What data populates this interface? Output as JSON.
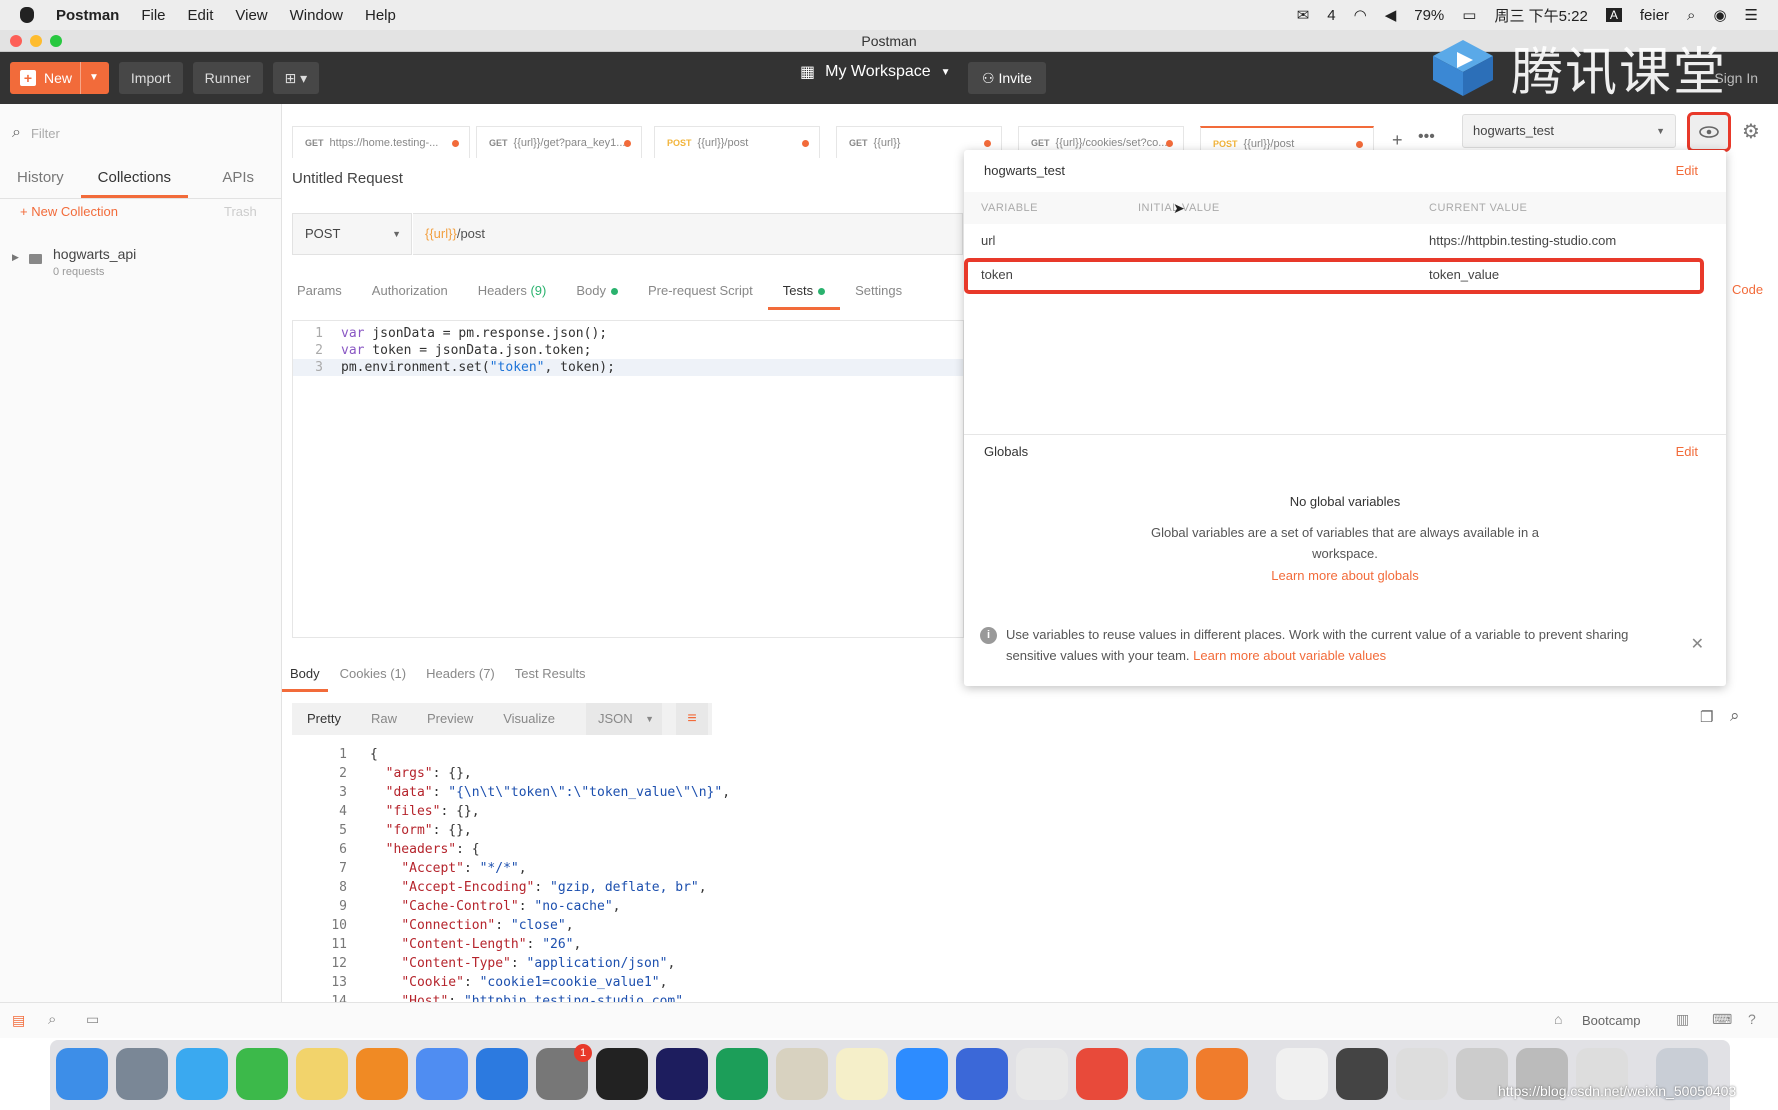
{
  "menubar": {
    "app_name": "Postman",
    "items": [
      "File",
      "Edit",
      "View",
      "Window",
      "Help"
    ],
    "wechat_count": "4",
    "battery": "79%",
    "clock": "周三 下午5:22",
    "user": "feier"
  },
  "window": {
    "title": "Postman"
  },
  "toolbar": {
    "new_label": "New",
    "import_label": "Import",
    "runner_label": "Runner",
    "workspace_label": "My Workspace",
    "invite_label": "Invite",
    "signin_label": "Sign In"
  },
  "watermark": {
    "text": "腾讯课堂"
  },
  "sidebar": {
    "filter_placeholder": "Filter",
    "tabs": [
      "History",
      "Collections",
      "APIs"
    ],
    "active_tab": "Collections",
    "new_collection_label": "New Collection",
    "trash_label": "Trash",
    "collections": [
      {
        "name": "hogwarts_api",
        "subtitle": "0 requests"
      }
    ]
  },
  "request_tabs": [
    {
      "method": "GET",
      "label": "https://home.testing-..."
    },
    {
      "method": "GET",
      "label": "{{url}}/get?para_key1..."
    },
    {
      "method": "POST",
      "label": "{{url}}/post"
    },
    {
      "method": "GET",
      "label": "{{url}}"
    },
    {
      "method": "GET",
      "label": "{{url}}/cookies/set?co..."
    },
    {
      "method": "POST",
      "label": "{{url}}/post"
    }
  ],
  "env_selector": {
    "selected": "hogwarts_test"
  },
  "request": {
    "name": "Untitled Request",
    "method": "POST",
    "url_var": "{{url}}",
    "url_path": "/post",
    "option_tabs": {
      "params": "Params",
      "authorization": "Authorization",
      "headers": "Headers",
      "headers_count": "(9)",
      "body": "Body",
      "prerequest": "Pre-request Script",
      "tests": "Tests",
      "settings": "Settings"
    },
    "code_label": "Code",
    "test_script": {
      "line_numbers": [
        "1",
        "2",
        "3"
      ],
      "l1_kw": "var",
      "l1_rest": " jsonData = pm.response.json();",
      "l2_kw": "var",
      "l2_rest": " token = jsonData.json.token;",
      "l3_a": "pm.environment.set(",
      "l3_str": "\"token\"",
      "l3_b": ", token);"
    }
  },
  "response": {
    "tabs": {
      "body": "Body",
      "cookies": "Cookies (1)",
      "headers": "Headers (7)",
      "test_results": "Test Results"
    },
    "view_buttons": [
      "Pretty",
      "Raw",
      "Preview",
      "Visualize"
    ],
    "format": "JSON",
    "body_lines": [
      {
        "n": "1",
        "indent": "",
        "key": "",
        "val": "",
        "raw": "{"
      },
      {
        "n": "2",
        "indent": "  ",
        "key": "\"args\"",
        "val": "",
        "raw": ": {},"
      },
      {
        "n": "3",
        "indent": "  ",
        "key": "\"data\"",
        "val": "\"{\\n\\t\\\"token\\\":\\\"token_value\\\"\\n}\"",
        "raw": ","
      },
      {
        "n": "4",
        "indent": "  ",
        "key": "\"files\"",
        "val": "",
        "raw": ": {},"
      },
      {
        "n": "5",
        "indent": "  ",
        "key": "\"form\"",
        "val": "",
        "raw": ": {},"
      },
      {
        "n": "6",
        "indent": "  ",
        "key": "\"headers\"",
        "val": "",
        "raw": ": {"
      },
      {
        "n": "7",
        "indent": "    ",
        "key": "\"Accept\"",
        "val": "\"*/*\"",
        "raw": ","
      },
      {
        "n": "8",
        "indent": "    ",
        "key": "\"Accept-Encoding\"",
        "val": "\"gzip, deflate, br\"",
        "raw": ","
      },
      {
        "n": "9",
        "indent": "    ",
        "key": "\"Cache-Control\"",
        "val": "\"no-cache\"",
        "raw": ","
      },
      {
        "n": "10",
        "indent": "    ",
        "key": "\"Connection\"",
        "val": "\"close\"",
        "raw": ","
      },
      {
        "n": "11",
        "indent": "    ",
        "key": "\"Content-Length\"",
        "val": "\"26\"",
        "raw": ","
      },
      {
        "n": "12",
        "indent": "    ",
        "key": "\"Content-Type\"",
        "val": "\"application/json\"",
        "raw": ","
      },
      {
        "n": "13",
        "indent": "    ",
        "key": "\"Cookie\"",
        "val": "\"cookie1=cookie_value1\"",
        "raw": ","
      },
      {
        "n": "14",
        "indent": "    ",
        "key": "\"Host\"",
        "val": "\"httpbin.testing-studio.com\"",
        "raw": ""
      }
    ]
  },
  "env_popover": {
    "env_name": "hogwarts_test",
    "edit_label": "Edit",
    "columns": {
      "variable": "VARIABLE",
      "initial": "INITIAL VALUE",
      "current": "CURRENT VALUE"
    },
    "variables": [
      {
        "name": "url",
        "initial": "",
        "current": "https://httpbin.testing-studio.com"
      },
      {
        "name": "token",
        "initial": "",
        "current": "token_value"
      }
    ],
    "globals_title": "Globals",
    "globals_edit": "Edit",
    "no_globals": "No global variables",
    "globals_desc": "Global variables are a set of variables that are always available in a workspace.",
    "learn_globals": "Learn more about globals",
    "info_text": "Use variables to reuse values in different places. Work with the current value of a variable to prevent sharing sensitive values with your team.",
    "info_link": "Learn more about variable values"
  },
  "statusbar": {
    "bootcamp_label": "Bootcamp"
  },
  "dock": {
    "blog_url": "https://blog.csdn.net/weixin_50050403",
    "badge": "1"
  },
  "colors": {
    "accent": "#f26b3a",
    "highlight": "#e8392a",
    "toolbar": "#333333"
  }
}
